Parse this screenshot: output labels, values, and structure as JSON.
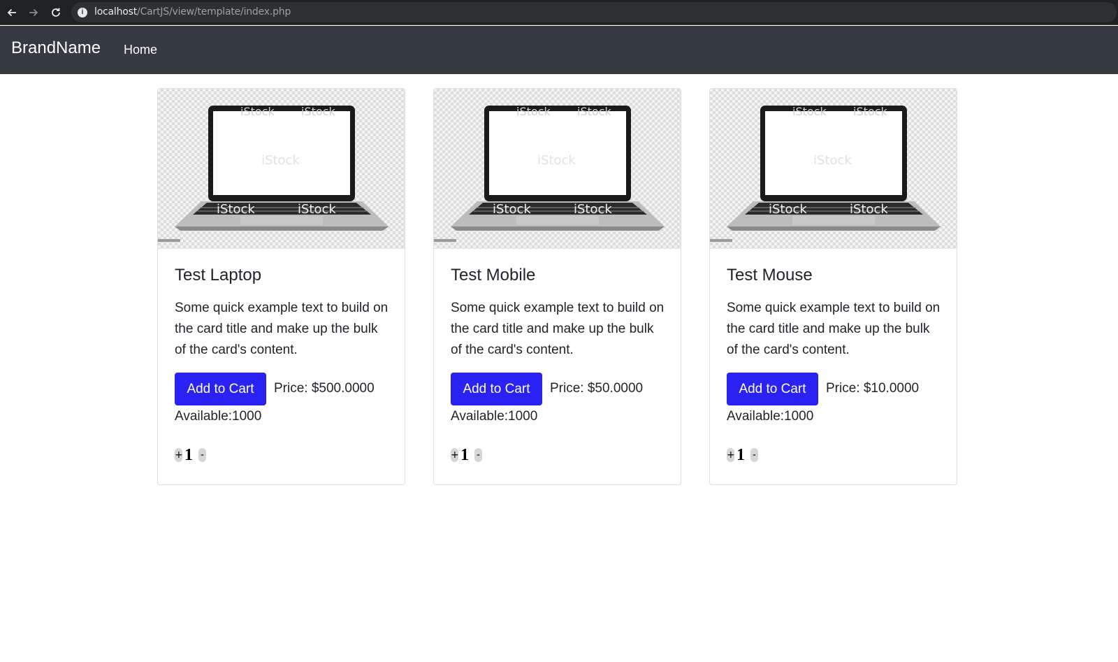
{
  "browser": {
    "url_host": "localhost",
    "url_path": "/CartJS/view/template/index.php"
  },
  "navbar": {
    "brand": "BrandName",
    "links": [
      {
        "label": "Home"
      }
    ]
  },
  "products": [
    {
      "title": "Test Laptop",
      "text": "Some quick example text to build on the card title and make up the bulk of the card's content.",
      "button": "Add to Cart",
      "price": "Price: $500.0000",
      "available": "Available:1000",
      "qty_plus": "+",
      "qty_value": "1",
      "qty_minus": "-"
    },
    {
      "title": "Test Mobile",
      "text": "Some quick example text to build on the card title and make up the bulk of the card's content.",
      "button": "Add to Cart",
      "price": "Price: $50.0000",
      "available": "Available:1000",
      "qty_plus": "+",
      "qty_value": "1",
      "qty_minus": "-"
    },
    {
      "title": "Test Mouse",
      "text": "Some quick example text to build on the card title and make up the bulk of the card's content.",
      "button": "Add to Cart",
      "price": "Price: $10.0000",
      "available": "Available:1000",
      "qty_plus": "+",
      "qty_value": "1",
      "qty_minus": "-"
    }
  ],
  "colors": {
    "navbar_bg": "#343a40",
    "button_bg": "#2a22f2",
    "browser_bg": "#202124"
  }
}
